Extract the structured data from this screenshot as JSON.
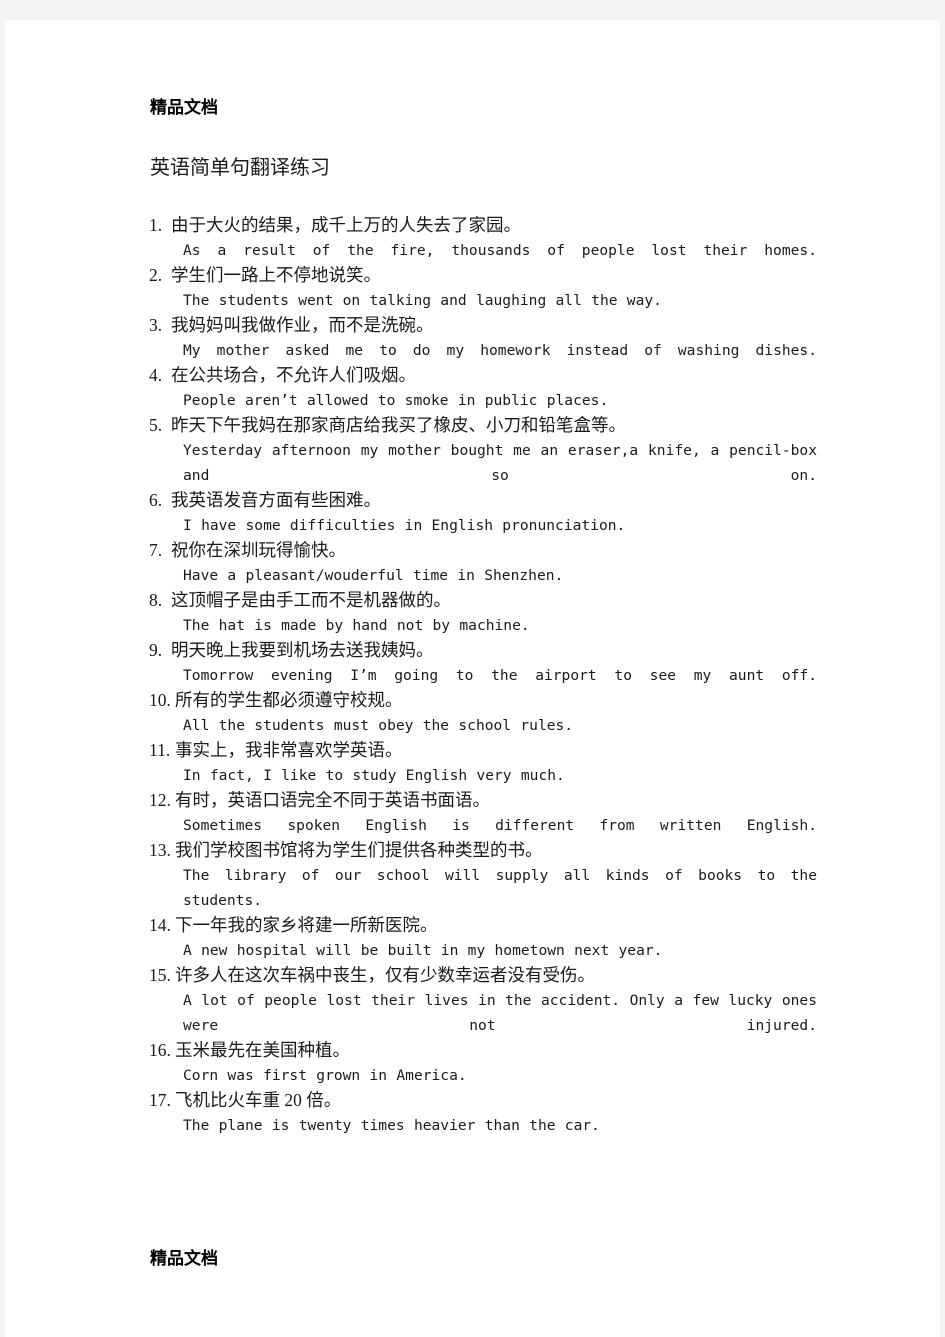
{
  "document": {
    "watermark_top": "精品文档",
    "watermark_bottom": "精品文档",
    "title": "英语简单句翻译练习"
  },
  "exercises": [
    {
      "number": "1.",
      "chinese": "由于大火的结果，成千上万的人失去了家园。",
      "english": "As a result of the fire, thousands of people lost their homes.",
      "wrap": true
    },
    {
      "number": "2.",
      "chinese": "学生们一路上不停地说笑。",
      "english": "The students went on talking and laughing all the way.",
      "wrap": false
    },
    {
      "number": "3.",
      "chinese": "我妈妈叫我做作业，而不是洗碗。",
      "english": "My mother asked me to do my homework instead of washing dishes.",
      "wrap": true
    },
    {
      "number": "4.",
      "chinese": "在公共场合，不允许人们吸烟。",
      "english": "People aren’t allowed to smoke in public places.",
      "wrap": false
    },
    {
      "number": "5.",
      "chinese": "昨天下午我妈在那家商店给我买了橡皮、小刀和铅笔盒等。",
      "english": "Yesterday afternoon my mother bought me an eraser,a knife, a pencil-box and so on.",
      "wrap": true
    },
    {
      "number": "6.",
      "chinese": "我英语发音方面有些困难。",
      "english": "I have some difficulties in English pronunciation.",
      "wrap": false
    },
    {
      "number": "7.",
      "chinese": "祝你在深圳玩得愉快。",
      "english": "Have a pleasant/wouderful time in Shenzhen.",
      "wrap": false
    },
    {
      "number": "8.",
      "chinese": "这顶帽子是由手工而不是机器做的。",
      "english": "The hat is made by hand not by machine.",
      "wrap": false
    },
    {
      "number": "9.",
      "chinese": "明天晚上我要到机场去送我姨妈。",
      "english": "Tomorrow evening I’m going to the airport to see my aunt off.",
      "wrap": true
    },
    {
      "number": "10.",
      "chinese": "所有的学生都必须遵守校规。",
      "english": "All the students must obey the school rules.",
      "wrap": false
    },
    {
      "number": "11.",
      "chinese": "事实上，我非常喜欢学英语。",
      "english": "In fact, I like to study English very much.",
      "wrap": false
    },
    {
      "number": "12.",
      "chinese": "有时，英语口语完全不同于英语书面语。",
      "english": "Sometimes spoken English is different from written English.",
      "wrap": false,
      "full_width": true
    },
    {
      "number": "13.",
      "chinese": "我们学校图书馆将为学生们提供各种类型的书。",
      "english": "The library of our school will supply all kinds of books to the students.",
      "wrap": true
    },
    {
      "number": "14.",
      "chinese": "下一年我的家乡将建一所新医院。",
      "english": "A new hospital will be built in my hometown next year.",
      "wrap": false
    },
    {
      "number": "15.",
      "chinese": "许多人在这次车祸中丧生，仅有少数幸运者没有受伤。",
      "english": "A lot of people lost their lives in the accident. Only a few lucky ones were not injured.",
      "wrap": true
    },
    {
      "number": "16.",
      "chinese": "玉米最先在美国种植。",
      "english": "Corn was first grown in America.",
      "wrap": false
    },
    {
      "number": "17.",
      "chinese": "飞机比火车重 20 倍。",
      "english": "The plane is twenty times heavier than the car.",
      "wrap": false
    }
  ],
  "colors": {
    "page_background": "#ffffff",
    "canvas_background": "#f4f4f4",
    "text": "#1a1a1a"
  }
}
